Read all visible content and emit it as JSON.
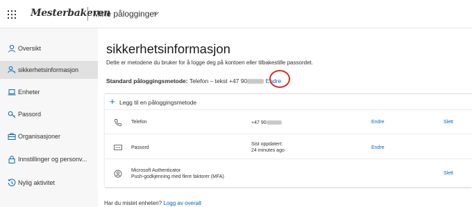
{
  "header": {
    "brand": "Mesterbakeren",
    "app_title": "Mine pålogginger"
  },
  "sidebar": {
    "items": [
      {
        "label": "Oversikt",
        "icon": "person-icon"
      },
      {
        "label": "sikkerhetsinformasjon",
        "icon": "security-info-icon",
        "active": true
      },
      {
        "label": "Enheter",
        "icon": "laptop-icon"
      },
      {
        "label": "Passord",
        "icon": "key-icon"
      },
      {
        "label": "Organisasjoner",
        "icon": "briefcase-icon"
      },
      {
        "label": "Innstillinger og personv...",
        "icon": "lock-icon"
      },
      {
        "label": "Nylig aktivitet",
        "icon": "history-icon"
      }
    ]
  },
  "main": {
    "title": "sikkerhetsinformasjon",
    "subtitle": "Dette er metodene du bruker for å logge deg på kontoen eller tilbakestille passordet.",
    "default_method_label": "Standard påloggingsmetode:",
    "default_method_value": "Telefon – tekst +47 90",
    "default_method_edit": "Endre",
    "add_method": "Legg til en påloggingsmetode",
    "methods": [
      {
        "name": "Telefon",
        "detail": "+47 90",
        "edit": "Endre",
        "delete": "Slett",
        "icon": "phone-icon"
      },
      {
        "name": "Passord",
        "detail_line1": "Sist oppdatert:",
        "detail_line2": "24 minutes ago",
        "edit": "Endre",
        "icon": "password-icon"
      },
      {
        "name": "Microsoft Authenticator",
        "name_line2": "Push-godkjenning med flere faktorer (MFA)",
        "delete": "Slett",
        "icon": "authenticator-icon"
      }
    ],
    "lost_device_prefix": "Har du mistet enheten?",
    "lost_device_link": "Logg av overalt"
  },
  "colors": {
    "accent": "#0067b8",
    "highlight_circle": "#e12826",
    "sidebar_bg": "#f7f7f7",
    "sidebar_active_bg": "#e1e1e1"
  }
}
